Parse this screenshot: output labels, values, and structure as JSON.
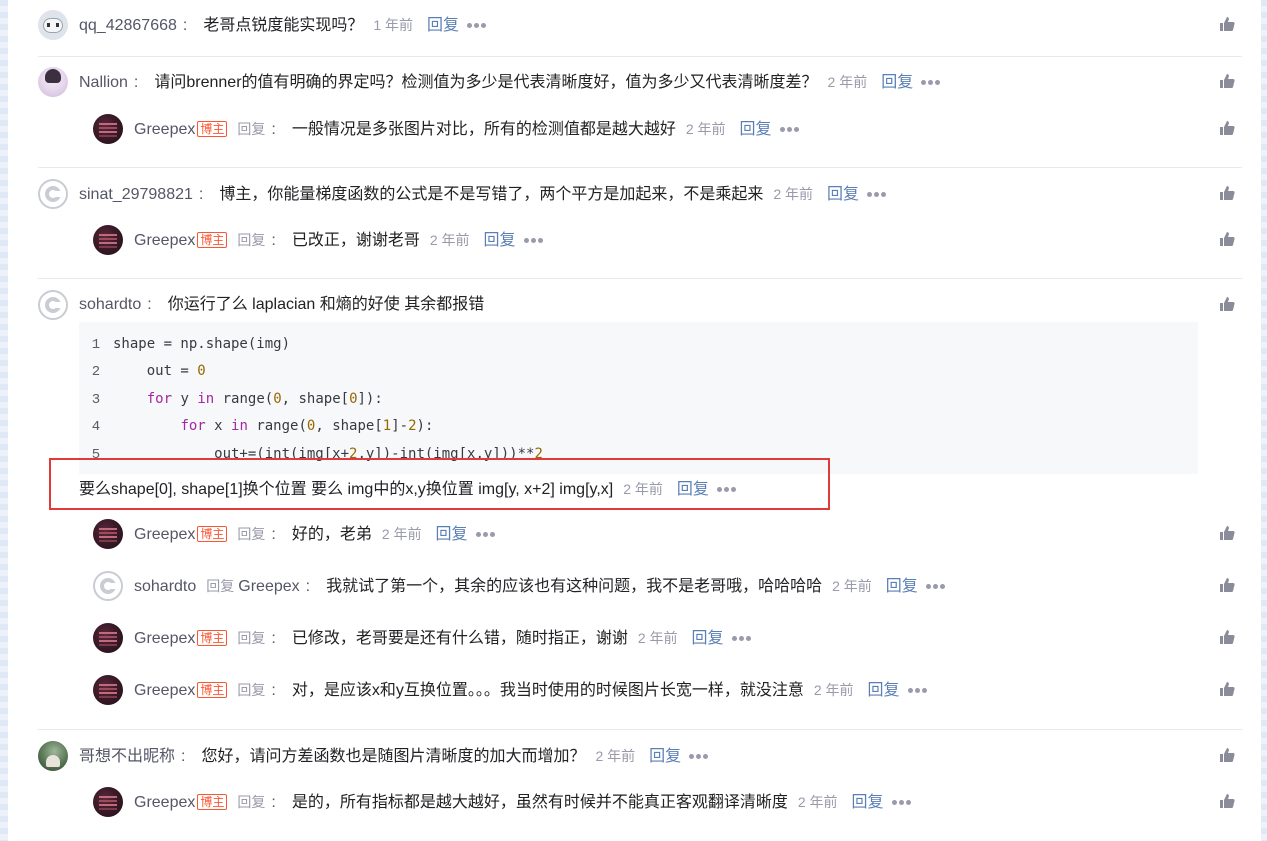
{
  "reply_label": "回复",
  "blogger_tag": "博主",
  "comments": [
    {
      "user": "qq_42867668",
      "text": "老哥点锐度能实现吗？",
      "time": "1 年前",
      "reply": "回复",
      "avatar": "robot-avatar"
    },
    {
      "user": "Nallion",
      "text": "请问brenner的值有明确的界定吗？检测值为多少是代表清晰度好，值为多少又代表清晰度差？",
      "time": "2 年前",
      "reply": "回复",
      "avatar": "girl-avatar",
      "replies": [
        {
          "user": "Greepex",
          "tag": "博主",
          "reply_label": "回复",
          "text": "一般情况是多张图片对比，所有的检测值都是越大越好",
          "time": "2 年前",
          "reply": "回复"
        }
      ]
    },
    {
      "user": "sinat_29798821",
      "text": "博主，你能量梯度函数的公式是不是写错了，两个平方是加起来，不是乘起来",
      "time": "2 年前",
      "reply": "回复",
      "avatar": "ring-avatar",
      "replies": [
        {
          "user": "Greepex",
          "tag": "博主",
          "reply_label": "回复",
          "text": "已改正，谢谢老哥",
          "time": "2 年前",
          "reply": "回复"
        }
      ]
    },
    {
      "user": "sohardto",
      "text": "你运行了么 laplacian 和熵的好使 其余都报错",
      "avatar": "ring-avatar",
      "code": [
        {
          "n": "1",
          "text": "shape = np.shape(img)"
        },
        {
          "n": "2",
          "text": "    out = 0"
        },
        {
          "n": "3",
          "text": "    for y in range(0, shape[0]):"
        },
        {
          "n": "4",
          "text": "        for x in range(0, shape[1]-2):"
        },
        {
          "n": "5",
          "text": "            out+=(int(img[x+2,y])-int(img[x,y]))**2"
        }
      ],
      "tail_text": "要么shape[0], shape[1]换个位置 要么 img中的x,y换位置 img[y, x+2] img[y,x]",
      "time": "2 年前",
      "reply": "回复",
      "replies": [
        {
          "user": "Greepex",
          "tag": "博主",
          "reply_label": "回复",
          "text": "好的，老弟",
          "time": "2 年前",
          "reply": "回复"
        },
        {
          "user": "sohardto",
          "reply_label": "回复",
          "reply_to": "Greepex",
          "text": "我就试了第一个，其余的应该也有这种问题，我不是老哥哦，哈哈哈哈",
          "time": "2 年前",
          "reply": "回复"
        },
        {
          "user": "Greepex",
          "tag": "博主",
          "reply_label": "回复",
          "text": "已修改，老哥要是还有什么错，随时指正，谢谢",
          "time": "2 年前",
          "reply": "回复"
        },
        {
          "user": "Greepex",
          "tag": "博主",
          "reply_label": "回复",
          "text": "对，是应该x和y互换位置。。。我当时使用的时候图片长宽一样，就没注意",
          "time": "2 年前",
          "reply": "回复"
        }
      ]
    },
    {
      "user": "哥想不出昵称",
      "text": "您好，请问方差函数也是随图片清晰度的加大而增加？",
      "time": "2 年前",
      "reply": "回复",
      "avatar": "nature-avatar",
      "replies": [
        {
          "user": "Greepex",
          "tag": "博主",
          "reply_label": "回复",
          "text": "是的，所有指标都是越大越好，虽然有时候并不能真正客观翻译清晰度",
          "time": "2 年前",
          "reply": "回复"
        }
      ]
    }
  ]
}
